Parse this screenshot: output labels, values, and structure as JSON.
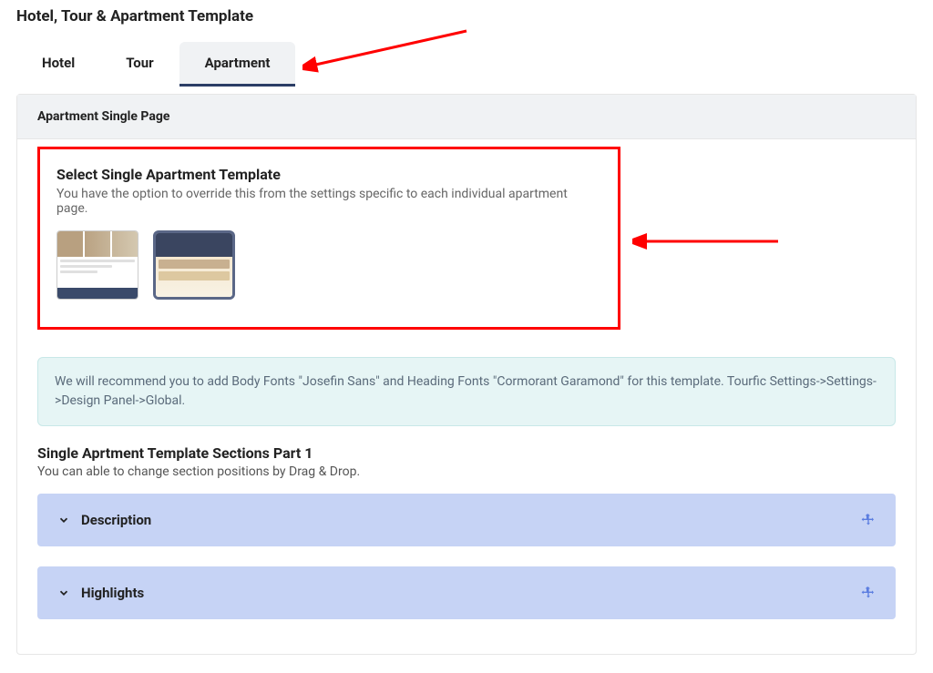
{
  "page_title": "Hotel, Tour & Apartment Template",
  "tabs": [
    {
      "label": "Hotel"
    },
    {
      "label": "Tour"
    },
    {
      "label": "Apartment"
    }
  ],
  "active_tab_index": 2,
  "panel_header": "Apartment Single Page",
  "template_section": {
    "title": "Select Single Apartment Template",
    "description": "You have the option to override this from the settings specific to each individual apartment page."
  },
  "info_note": "We will recommend you to add Body Fonts \"Josefin Sans\" and Heading Fonts \"Cormorant Garamond\" for this template. Tourfic Settings->Settings->Design Panel->Global.",
  "sections_block": {
    "title": "Single Aprtment Template Sections Part 1",
    "description": "You can able to change section positions by Drag & Drop."
  },
  "accordions": [
    {
      "label": "Description"
    },
    {
      "label": "Highlights"
    }
  ]
}
